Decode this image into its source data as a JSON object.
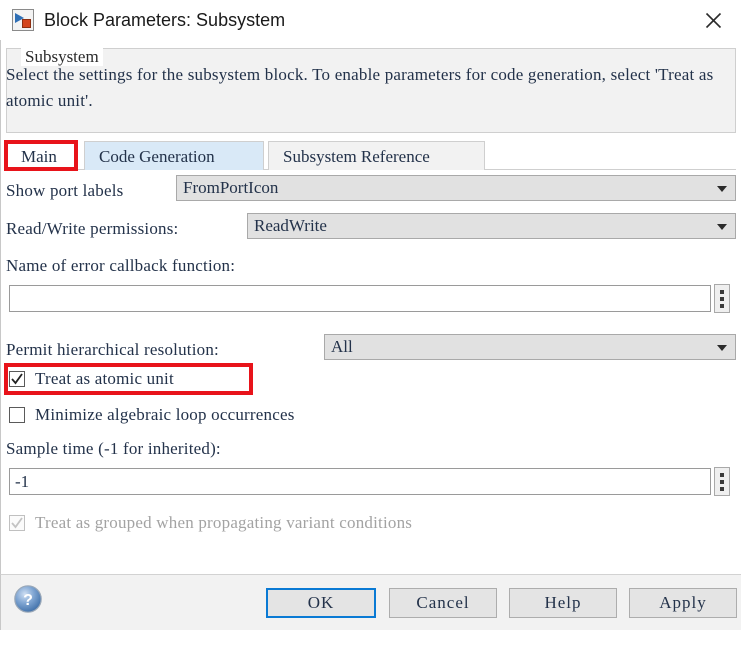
{
  "window": {
    "title": "Block Parameters: Subsystem",
    "icon": "subsystem-block-icon",
    "close_label": "✕"
  },
  "description_group": {
    "legend": "Subsystem",
    "text": "Select the settings for the subsystem block. To enable parameters for code generation, select 'Treat as atomic unit'."
  },
  "tabs": [
    {
      "label": "Main",
      "state": "active"
    },
    {
      "label": "Code Generation",
      "state": "hover"
    },
    {
      "label": "Subsystem Reference",
      "state": "idle"
    }
  ],
  "fields": {
    "show_port_labels": {
      "label": "Show port labels",
      "value": "FromPortIcon",
      "type": "dropdown"
    },
    "read_write_permissions": {
      "label": "Read/Write permissions:",
      "value": "ReadWrite",
      "type": "dropdown"
    },
    "error_callback": {
      "label": "Name of error callback function:",
      "value": "",
      "type": "text",
      "browse_icon": "vertical-dots-icon"
    },
    "permit_hierarchical_resolution": {
      "label": "Permit hierarchical resolution:",
      "value": "All",
      "type": "dropdown"
    },
    "sample_time": {
      "label": "Sample time (-1 for inherited):",
      "value": "-1",
      "type": "text",
      "browse_icon": "vertical-dots-icon"
    }
  },
  "checkboxes": {
    "treat_as_atomic_unit": {
      "label": "Treat as atomic unit",
      "checked": true,
      "enabled": true
    },
    "minimize_algebraic_loop": {
      "label": "Minimize algebraic loop occurrences",
      "checked": false,
      "enabled": true
    },
    "treat_as_grouped": {
      "label": "Treat as grouped when propagating variant conditions",
      "checked": true,
      "enabled": false
    }
  },
  "footer": {
    "help_icon": "help-question-icon",
    "buttons": [
      {
        "label": "OK",
        "primary": true
      },
      {
        "label": "Cancel",
        "primary": false
      },
      {
        "label": "Help",
        "primary": false
      },
      {
        "label": "Apply",
        "primary": false
      }
    ]
  },
  "annotations": {
    "accent_color": "#e8131a",
    "highlight_main_tab": "Main",
    "highlight_atomic_checkbox": "Treat as atomic unit"
  }
}
